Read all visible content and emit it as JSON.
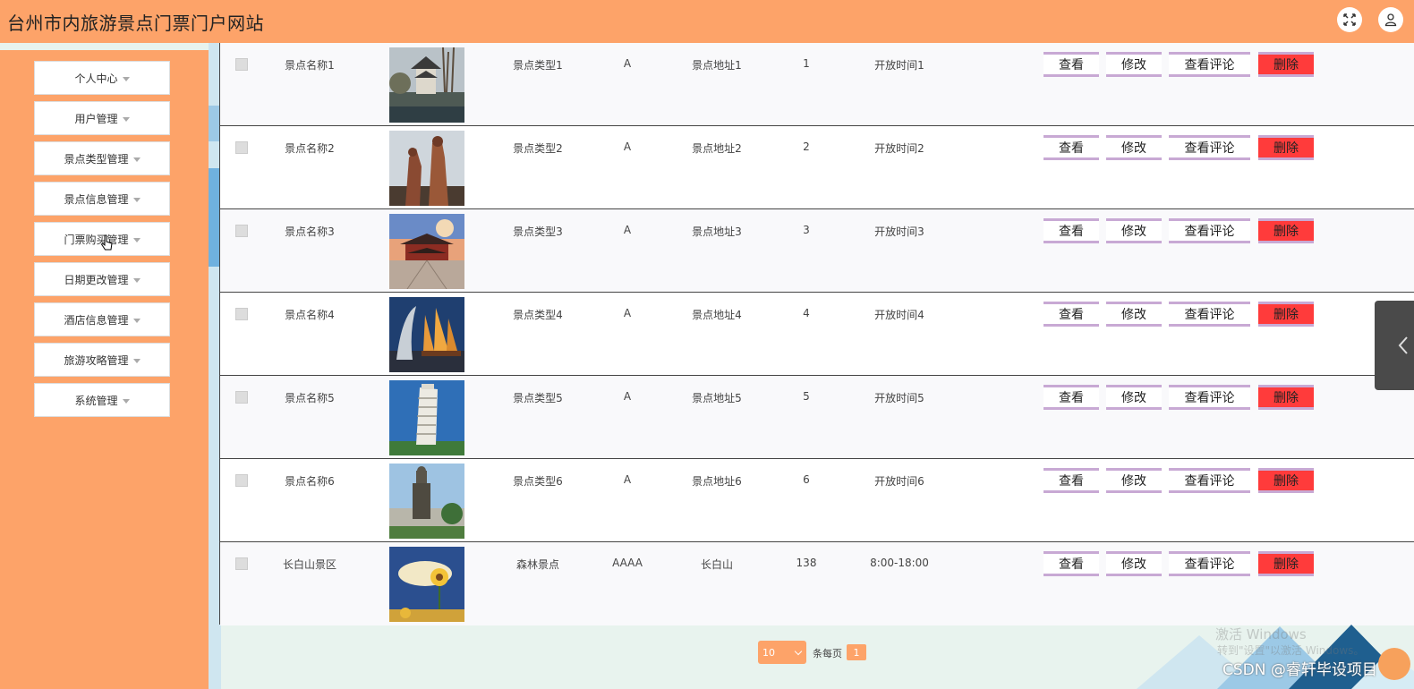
{
  "header": {
    "title": "台州市内旅游景点门票门户网站"
  },
  "sidebar": {
    "items": [
      {
        "label": "个人中心"
      },
      {
        "label": "用户管理"
      },
      {
        "label": "景点类型管理"
      },
      {
        "label": "景点信息管理"
      },
      {
        "label": "门票购买管理"
      },
      {
        "label": "日期更改管理"
      },
      {
        "label": "酒店信息管理"
      },
      {
        "label": "旅游攻略管理"
      },
      {
        "label": "系统管理"
      }
    ]
  },
  "table": {
    "rows": [
      {
        "name": "景点名称1",
        "type": "景点类型1",
        "level": "A",
        "address": "景点地址1",
        "num": "1",
        "time": "开放时间1"
      },
      {
        "name": "景点名称2",
        "type": "景点类型2",
        "level": "A",
        "address": "景点地址2",
        "num": "2",
        "time": "开放时间2"
      },
      {
        "name": "景点名称3",
        "type": "景点类型3",
        "level": "A",
        "address": "景点地址3",
        "num": "3",
        "time": "开放时间3"
      },
      {
        "name": "景点名称4",
        "type": "景点类型4",
        "level": "A",
        "address": "景点地址4",
        "num": "4",
        "time": "开放时间4"
      },
      {
        "name": "景点名称5",
        "type": "景点类型5",
        "level": "A",
        "address": "景点地址5",
        "num": "5",
        "time": "开放时间5"
      },
      {
        "name": "景点名称6",
        "type": "景点类型6",
        "level": "A",
        "address": "景点地址6",
        "num": "6",
        "time": "开放时间6"
      },
      {
        "name": "长白山景区",
        "type": "森林景点",
        "level": "AAAA",
        "address": "长白山",
        "num": "138",
        "time": "8:00-18:00"
      }
    ],
    "actions": {
      "view": "查看",
      "edit": "修改",
      "comment": "查看评论",
      "delete": "删除"
    }
  },
  "pagination": {
    "page_size": "10",
    "per_page_label": "条每页",
    "current_page": "1"
  },
  "watermark": {
    "line1": "激活 Windows",
    "line2": "转到\"设置\"以激活 Windows。",
    "csdn": "CSDN @睿轩毕设项目"
  },
  "colors": {
    "primary": "#fda369",
    "delete": "#ff3b3b",
    "bg": "#e8f3ee"
  }
}
